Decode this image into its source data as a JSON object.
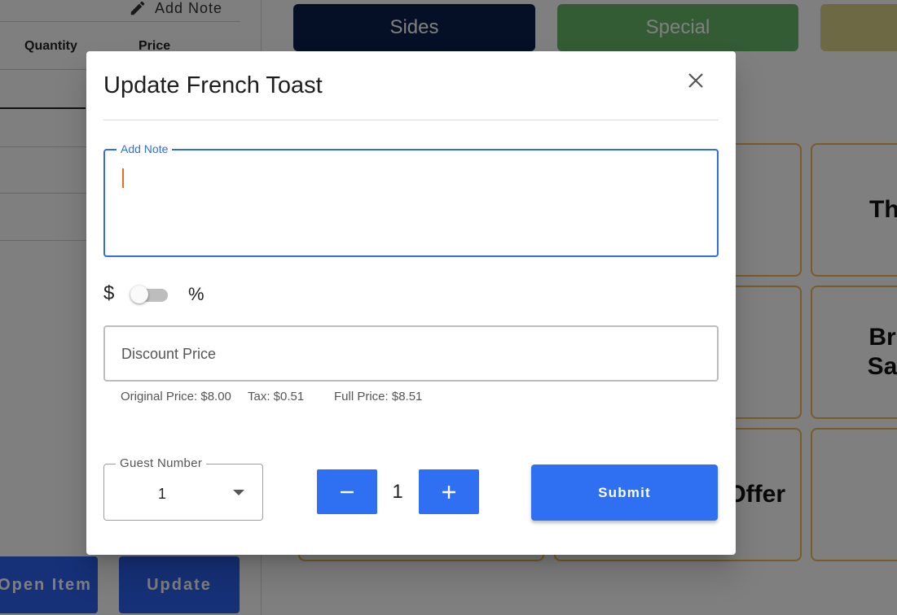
{
  "background": {
    "order_panel": {
      "add_note_label": "Add Note",
      "columns": {
        "quantity": "Quantity",
        "price": "Price"
      },
      "buttons": {
        "open_item": "Open Item",
        "update": "Update"
      }
    },
    "categories": [
      {
        "label": "Sides",
        "color": "#0b1f4d"
      },
      {
        "label": "Special",
        "color": "#66b96b"
      },
      {
        "label": "",
        "color": "#dad38a"
      }
    ],
    "tiles": [
      "Th",
      "Br Sa",
      "Offer"
    ]
  },
  "modal": {
    "title": "Update French Toast",
    "note": {
      "label": "Add Note",
      "value": ""
    },
    "discount_mode": {
      "left_symbol": "$",
      "right_symbol": "%",
      "is_percent": false
    },
    "discount": {
      "placeholder": "Discount Price",
      "value": ""
    },
    "price_info": {
      "original": "Original Price: $8.00",
      "tax": "Tax: $0.51",
      "full": "Full Price: $8.51"
    },
    "guest": {
      "label": "Guest Number",
      "value": "1"
    },
    "quantity": {
      "value": "1"
    },
    "submit_label": "Submit"
  },
  "colors": {
    "accent": "#2f6ff2",
    "focus": "#2f6fe0",
    "tile_border": "#f2b84f"
  }
}
